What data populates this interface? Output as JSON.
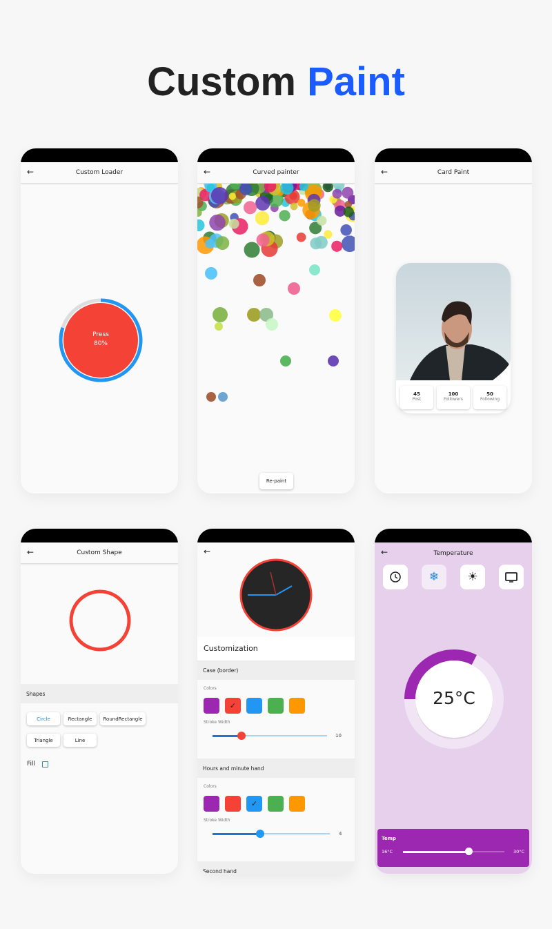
{
  "page_title": {
    "part1": "Custom",
    "part2": "Paint"
  },
  "colors": {
    "accent": "#1a5cff",
    "red": "#f44336",
    "blue": "#2196f3",
    "purple": "#9c27b0",
    "green": "#4caf50",
    "orange": "#ff9800"
  },
  "loader": {
    "title": "Custom Loader",
    "label": "Press",
    "percent_text": "80%",
    "progress": 0.8
  },
  "curved": {
    "title": "Curved painter",
    "repaint_label": "Re-paint"
  },
  "card": {
    "title": "Card Paint",
    "stats": [
      {
        "value": "45",
        "label": "Post"
      },
      {
        "value": "100",
        "label": "Followers"
      },
      {
        "value": "50",
        "label": "Following"
      }
    ]
  },
  "shape": {
    "title": "Custom Shape",
    "section": "Shapes",
    "buttons": [
      "Circle",
      "Rectangle",
      "RoundRectangle",
      "Triangle",
      "Line"
    ],
    "selected": "Circle",
    "fill_label": "Fill",
    "fill_checked": false
  },
  "clock": {
    "heading": "Customization",
    "case_section": "Case (border)",
    "colors_label": "Colors",
    "stroke_label": "Stroke Width",
    "case_stroke": "10",
    "case_color": "red",
    "hands_section": "Hours and minute hand",
    "hands_stroke": "4",
    "hands_color": "blue",
    "second_section": "Second hand"
  },
  "temperature": {
    "title": "Temperature",
    "value_text": "25°C",
    "value": 25,
    "min": 16,
    "max": 30,
    "min_text": "16°C",
    "max_text": "30°C",
    "slider_label": "Temp",
    "icons": [
      "clock-icon",
      "snowflake-icon",
      "sun-icon",
      "tv-icon"
    ],
    "selected_icon": "snowflake-icon"
  }
}
